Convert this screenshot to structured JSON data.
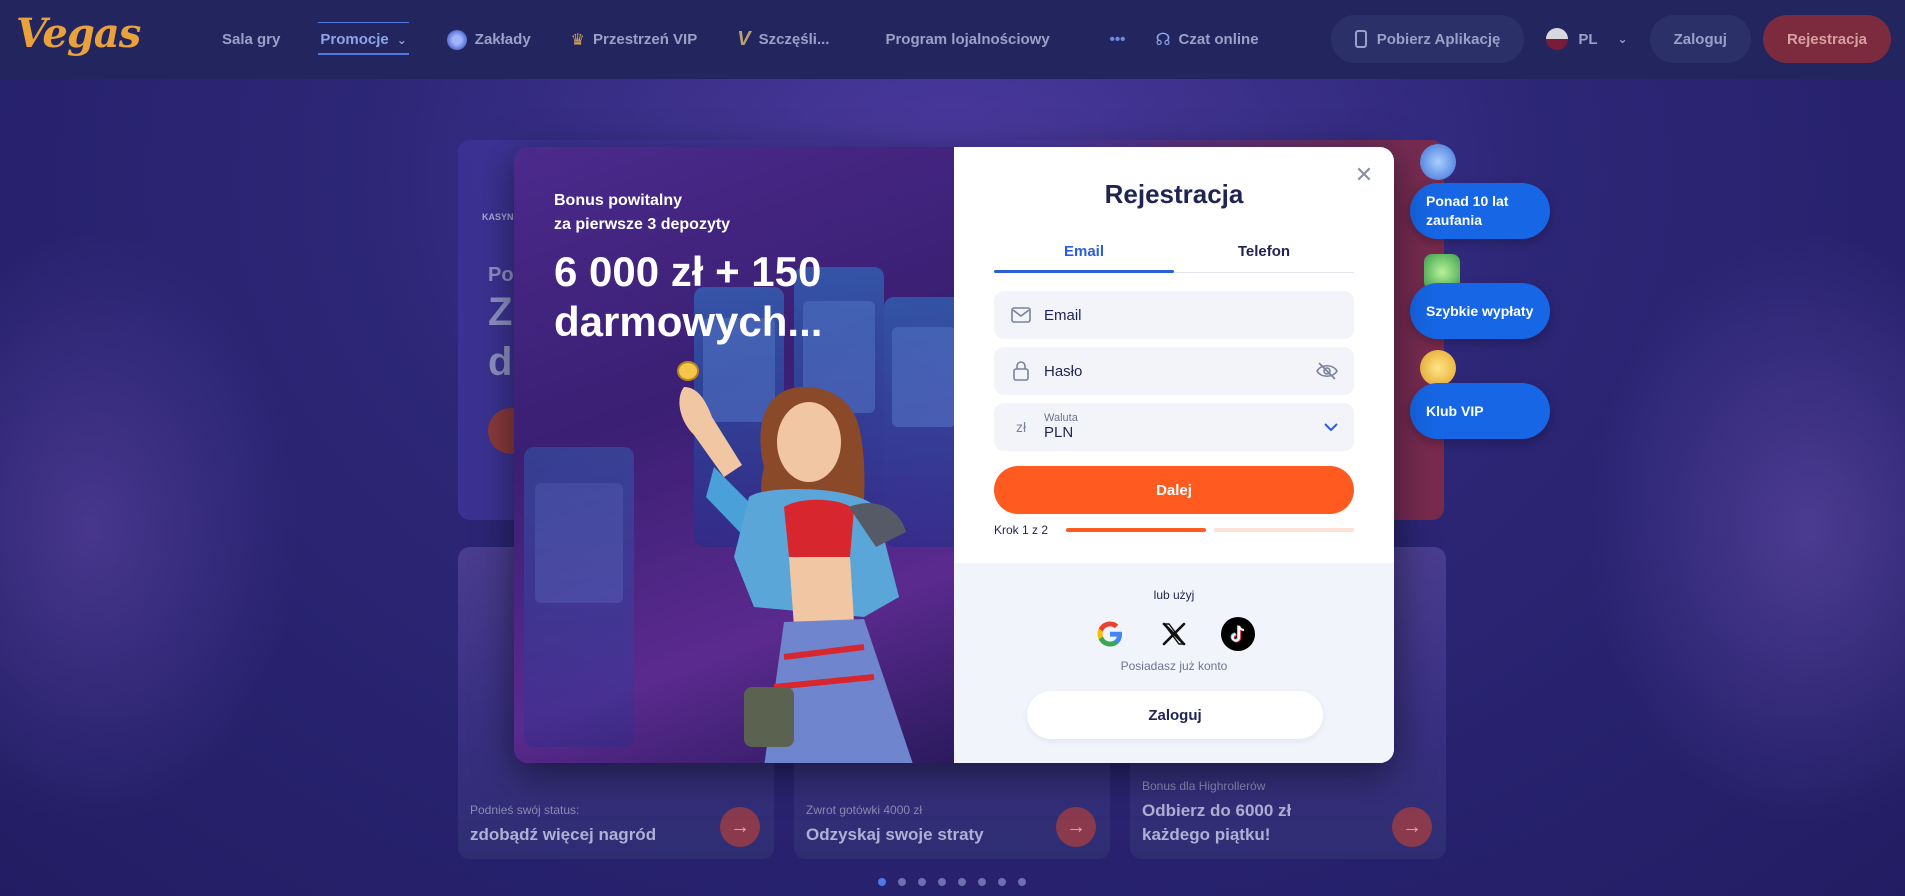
{
  "header": {
    "logo": "Vegas",
    "nav": [
      {
        "label": "Sala gry"
      },
      {
        "label": "Promocje"
      },
      {
        "label": "Zakłady"
      },
      {
        "label": "Przestrzeń VIP"
      },
      {
        "label": "Szczęśli..."
      },
      {
        "label": "Program lojalnościowy"
      }
    ],
    "more": "•••",
    "chat": "Czat online",
    "app": "Pobierz Aplikację",
    "lang": "PL",
    "login": "Zaloguj",
    "register": "Rejestracja"
  },
  "background": {
    "cards": [
      {
        "small": "Podnieś swój status:",
        "big": "zdobądź więcej nagród"
      },
      {
        "small": "Zwrot gotówki 4000 zł",
        "big": "Odzyskaj swoje straty"
      },
      {
        "small": "Bonus dla Highrollerów",
        "big": "Odbierz do 6000 zł każdego piątku!"
      }
    ],
    "hero_fragments": {
      "line1": "Po",
      "line2": "Z",
      "line3": "d",
      "brand": "KASYNO"
    },
    "active_slide": 1,
    "slide_count": 8
  },
  "badges": [
    {
      "label": "Ponad 10 lat zaufania"
    },
    {
      "label": "Szybkie wypłaty"
    },
    {
      "label": "Klub VIP"
    }
  ],
  "modal": {
    "bonus_sub_1": "Bonus powitalny",
    "bonus_sub_2": "za pierwsze 3 depozyty",
    "bonus_main_1": "6 000 zł + 150",
    "bonus_main_2": "darmowych...",
    "title": "Rejestracja",
    "tabs": [
      {
        "label": "Email",
        "active": true
      },
      {
        "label": "Telefon",
        "active": false
      }
    ],
    "email_placeholder": "Email",
    "password_placeholder": "Hasło",
    "currency_label": "Waluta",
    "currency_symbol": "zł",
    "currency_value": "PLN",
    "next_label": "Dalej",
    "step_text": "Krok 1 z 2",
    "step_progress": 0.5,
    "or_use": "lub użyj",
    "socials": [
      "google-icon",
      "x-icon",
      "tiktok-icon"
    ],
    "have_account": "Posiadasz już konto",
    "login_label": "Zaloguj"
  },
  "colors": {
    "accent": "#ff5a1f",
    "primary_blue": "#2b5fd9",
    "badge_blue": "#1666e6",
    "header_bg": "#23255e"
  }
}
